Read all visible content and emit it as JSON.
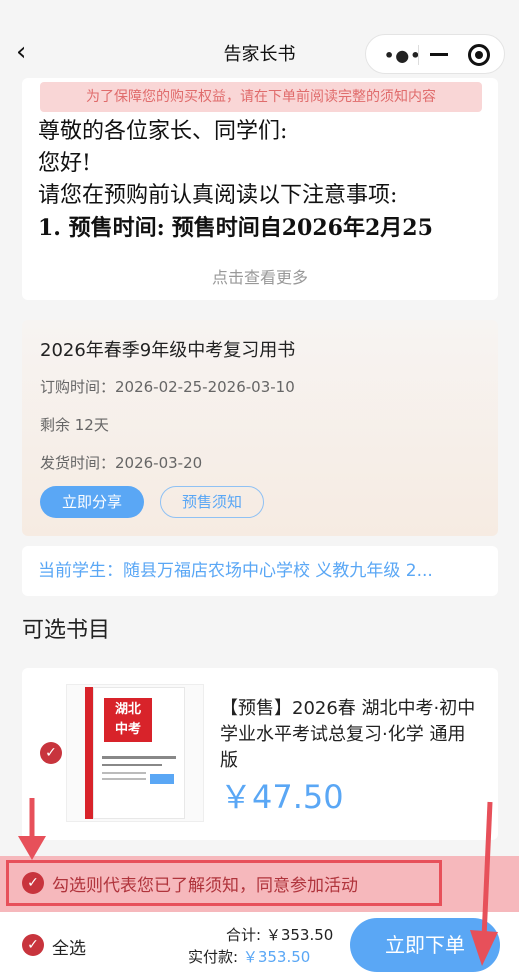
{
  "nav": {
    "title": "告家长书"
  },
  "notice": {
    "banner": "为了保障您的购买权益，请在下单前阅读完整的须知内容",
    "lines": [
      "尊敬的各位家长、同学们:",
      "您好!",
      "请您在预购前认真阅读以下注意事项:"
    ],
    "bold_label": "1. 预售时间:",
    "bold_rest": "预售时间自2026年2月25",
    "more": "点击查看更多"
  },
  "product": {
    "name": "2026年春季9年级中考复习用书",
    "order_time": "订购时间：2026-02-25-2026-03-10",
    "remaining": "剩余 12天",
    "ship_time": "发货时间：2026-03-20",
    "share_label": "立即分享",
    "rules_label": "预售须知"
  },
  "student": "当前学生：随县万福店农场中心学校 义教九年级 2...",
  "section_title": "可选书目",
  "book": {
    "title": "【预售】2026春 湖北中考·初中学业水平考试总复习·化学 通用版",
    "price": "￥47.50",
    "cover_logo_top": "湖北",
    "cover_logo_bottom": "中考"
  },
  "agree": {
    "text": "勾选则代表您已了解须知，同意参加活动"
  },
  "bottom": {
    "select_all": "全选",
    "total_label": "合计: ",
    "total_value": "￥353.50",
    "paid_label": "实付款: ",
    "paid_value": "￥353.50",
    "order_label": "立即下单"
  },
  "colors": {
    "accent": "#5aa7f5",
    "check_red": "#c8343d",
    "highlight": "#e7505a"
  }
}
